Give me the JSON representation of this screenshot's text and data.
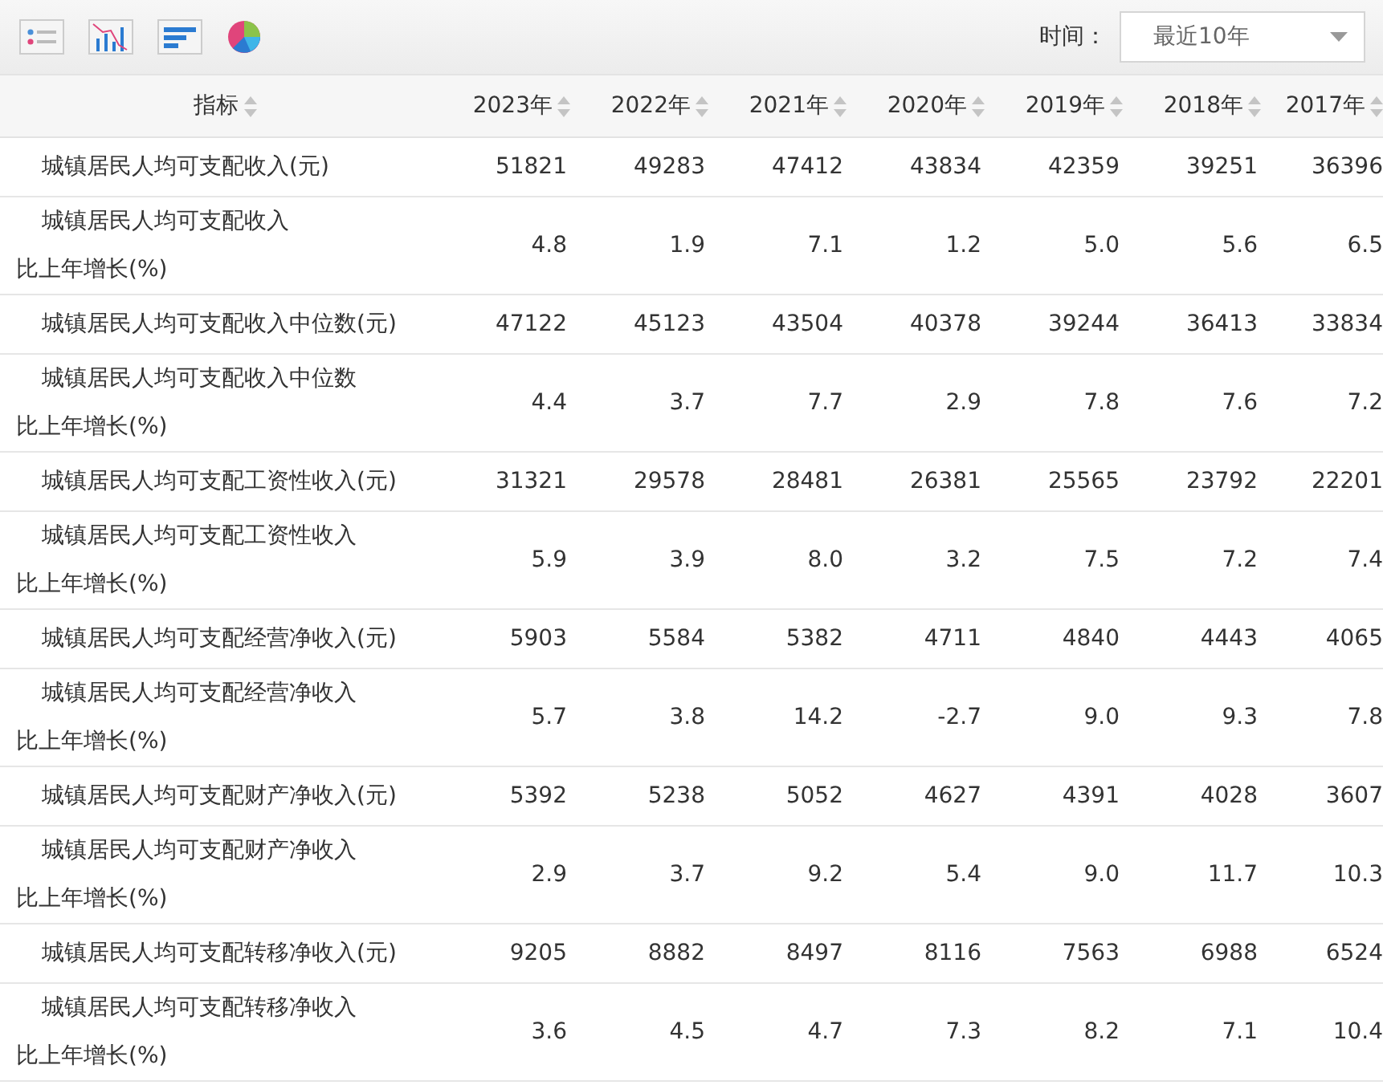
{
  "time_filter": {
    "label": "时间：",
    "value": "最近10年"
  },
  "table": {
    "columns": [
      "指标",
      "2023年",
      "2022年",
      "2021年",
      "2020年",
      "2019年",
      "2018年",
      "2017年"
    ],
    "rows": [
      {
        "label": [
          "城镇居民人均可支配收入(元)"
        ],
        "values": [
          "51821",
          "49283",
          "47412",
          "43834",
          "42359",
          "39251",
          "36396"
        ]
      },
      {
        "label": [
          "城镇居民人均可支配收入",
          "比上年增长(%)"
        ],
        "values": [
          "4.8",
          "1.9",
          "7.1",
          "1.2",
          "5.0",
          "5.6",
          "6.5"
        ]
      },
      {
        "label": [
          "城镇居民人均可支配收入中位数(元)"
        ],
        "values": [
          "47122",
          "45123",
          "43504",
          "40378",
          "39244",
          "36413",
          "33834"
        ]
      },
      {
        "label": [
          "城镇居民人均可支配收入中位数",
          "比上年增长(%)"
        ],
        "values": [
          "4.4",
          "3.7",
          "7.7",
          "2.9",
          "7.8",
          "7.6",
          "7.2"
        ]
      },
      {
        "label": [
          "城镇居民人均可支配工资性收入(元)"
        ],
        "values": [
          "31321",
          "29578",
          "28481",
          "26381",
          "25565",
          "23792",
          "22201"
        ]
      },
      {
        "label": [
          "城镇居民人均可支配工资性收入",
          "比上年增长(%)"
        ],
        "values": [
          "5.9",
          "3.9",
          "8.0",
          "3.2",
          "7.5",
          "7.2",
          "7.4"
        ]
      },
      {
        "label": [
          "城镇居民人均可支配经营净收入(元)"
        ],
        "values": [
          "5903",
          "5584",
          "5382",
          "4711",
          "4840",
          "4443",
          "4065"
        ]
      },
      {
        "label": [
          "城镇居民人均可支配经营净收入",
          "比上年增长(%)"
        ],
        "values": [
          "5.7",
          "3.8",
          "14.2",
          "-2.7",
          "9.0",
          "9.3",
          "7.8"
        ]
      },
      {
        "label": [
          "城镇居民人均可支配财产净收入(元)"
        ],
        "values": [
          "5392",
          "5238",
          "5052",
          "4627",
          "4391",
          "4028",
          "3607"
        ]
      },
      {
        "label": [
          "城镇居民人均可支配财产净收入",
          "比上年增长(%)"
        ],
        "values": [
          "2.9",
          "3.7",
          "9.2",
          "5.4",
          "9.0",
          "11.7",
          "10.3"
        ]
      },
      {
        "label": [
          "城镇居民人均可支配转移净收入(元)"
        ],
        "values": [
          "9205",
          "8882",
          "8497",
          "8116",
          "7563",
          "6988",
          "6524"
        ]
      },
      {
        "label": [
          "城镇居民人均可支配转移净收入",
          "比上年增长(%)"
        ],
        "values": [
          "3.6",
          "4.5",
          "4.7",
          "7.3",
          "8.2",
          "7.1",
          "10.4"
        ]
      }
    ]
  }
}
